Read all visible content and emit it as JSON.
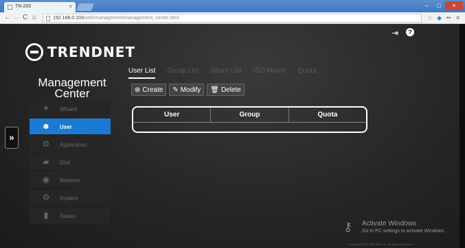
{
  "browser": {
    "tab_title": "TN-200",
    "tab_close": "×",
    "url_host": "192.168.0.103",
    "url_path": "/web/management/management_center.html",
    "window_min": "–",
    "window_max": "□",
    "window_close": "×"
  },
  "brand": "TRENDNET",
  "header": {
    "title": "Management Center"
  },
  "sidebar": {
    "items": [
      {
        "label": "Wizard",
        "icon": "wizard-icon",
        "glyph": "✶"
      },
      {
        "label": "User",
        "icon": "user-icon",
        "glyph": "☻",
        "active": true
      },
      {
        "label": "Application",
        "icon": "application-icon",
        "glyph": "⚙"
      },
      {
        "label": "Disk",
        "icon": "disk-icon",
        "glyph": "▰"
      },
      {
        "label": "Network",
        "icon": "network-icon",
        "glyph": "◉"
      },
      {
        "label": "System",
        "icon": "system-icon",
        "glyph": "⚙"
      },
      {
        "label": "Status",
        "icon": "status-icon",
        "glyph": "▮"
      }
    ]
  },
  "tabs": [
    "User List",
    "Group List",
    "Share List",
    "ISO Mount",
    "Quota"
  ],
  "actions": {
    "create": "Create",
    "modify": "Modify",
    "delete": "Delete"
  },
  "table": {
    "columns": [
      "User",
      "Group",
      "Quota"
    ]
  },
  "watermark": {
    "title": "Activate Windows",
    "subtitle": "Go to PC settings to activate Windows.",
    "copyright": "Copyright©2013 TRENDnet Inc. All Rights Reserved."
  },
  "colors": {
    "accent": "#1b7bd4",
    "background": "#262626"
  }
}
